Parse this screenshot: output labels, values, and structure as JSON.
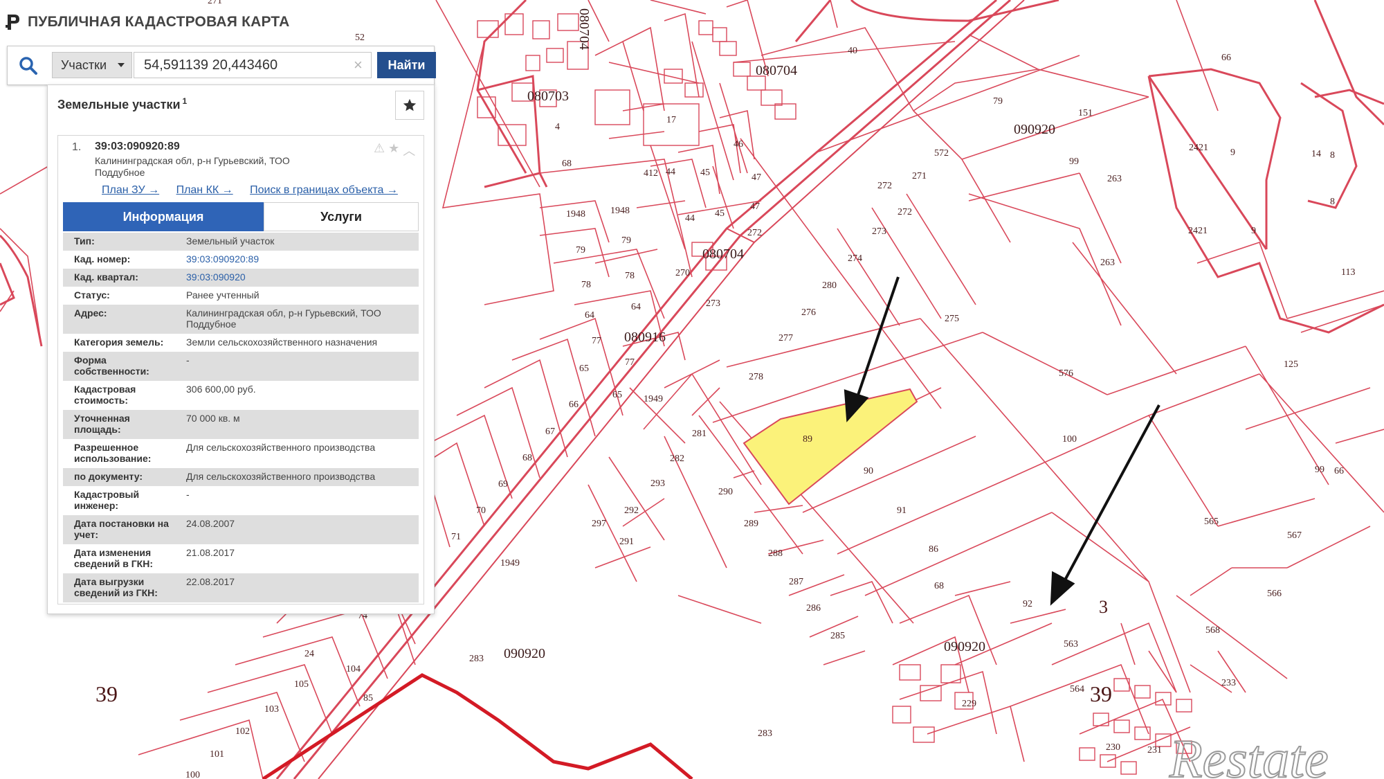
{
  "header": {
    "title": "ПУБЛИЧНАЯ КАДАСТРОВАЯ КАРТА"
  },
  "search": {
    "type_selected": "Участки",
    "value": "54,591139 20,443460",
    "button_label": "Найти",
    "clear_glyph": "×"
  },
  "results": {
    "title": "Земельные участки",
    "count": "1",
    "items": [
      {
        "number": "1.",
        "cad_id": "39:03:090920:89",
        "address": "Калининградская обл, р-н Гурьевский, ТОО Поддубное",
        "links": [
          "План ЗУ →",
          "План КК →",
          "Поиск в границах объекта →"
        ],
        "tabs": [
          "Информация",
          "Услуги"
        ],
        "info": [
          {
            "label": "Тип:",
            "value": "Земельный участок"
          },
          {
            "label": "Кад. номер:",
            "value": "39:03:090920:89"
          },
          {
            "label": "Кад. квартал:",
            "value": "39:03:090920"
          },
          {
            "label": "Статус:",
            "value": "Ранее учтенный"
          },
          {
            "label": "Адрес:",
            "value": "Калининградская обл, р-н Гурьевский, ТОО Поддубное"
          },
          {
            "label": "Категория земель:",
            "value": "Земли сельскохозяйственного назначения"
          },
          {
            "label": "Форма собственности:",
            "value": "-"
          },
          {
            "label": "Кадастровая стоимость:",
            "value": "306 600,00 руб."
          },
          {
            "label": "Уточненная площадь:",
            "value": "70 000 кв. м"
          },
          {
            "label": "Разрешенное использование:",
            "value": "Для сельскохозяйственного производства"
          },
          {
            "label": "по документу:",
            "value": "Для сельскохозяйственного производства"
          },
          {
            "label": "Кадастровый инженер:",
            "value": "-"
          },
          {
            "label": "Дата постановки на учет:",
            "value": "24.08.2007"
          },
          {
            "label": "Дата изменения сведений в ГКН:",
            "value": "21.08.2017"
          },
          {
            "label": "Дата выгрузки сведений из ГКН:",
            "value": "22.08.2017"
          }
        ]
      }
    ]
  },
  "map": {
    "colors": {
      "boundary": "#d9485a",
      "highlight": "#fbf27a",
      "arrow": "#111111"
    },
    "quarter_labels": [
      "080703",
      "080704",
      "080704",
      "080704",
      "080916",
      "090920",
      "090920",
      "090920"
    ],
    "district_labels": [
      "39",
      "39",
      "3"
    ],
    "parcel_labels": [
      "40",
      "79",
      "151",
      "66",
      "99",
      "263",
      "263",
      "2421",
      "9",
      "2421",
      "9",
      "14",
      "8",
      "8",
      "113",
      "572",
      "271",
      "272",
      "272",
      "273",
      "274",
      "280",
      "276",
      "277",
      "275",
      "278",
      "576",
      "125",
      "89",
      "90",
      "91",
      "100",
      "86",
      "68",
      "92",
      "563",
      "564",
      "565",
      "567",
      "566",
      "568",
      "99",
      "66",
      "282",
      "281",
      "293",
      "292",
      "291",
      "297",
      "290",
      "289",
      "288",
      "287",
      "286",
      "285",
      "1948",
      "1948",
      "79",
      "79",
      "78",
      "78",
      "64",
      "64",
      "77",
      "77",
      "65",
      "65",
      "66",
      "67",
      "68",
      "69",
      "70",
      "71",
      "1949",
      "1949",
      "412",
      "44",
      "45",
      "46",
      "47",
      "47",
      "44",
      "45",
      "270",
      "272",
      "273",
      "17",
      "4",
      "68",
      "52",
      "271",
      "74",
      "24",
      "104",
      "105",
      "103",
      "102",
      "101",
      "100",
      "85",
      "283",
      "283",
      "231",
      "230",
      "229",
      "233"
    ],
    "watermark": "Restate"
  }
}
